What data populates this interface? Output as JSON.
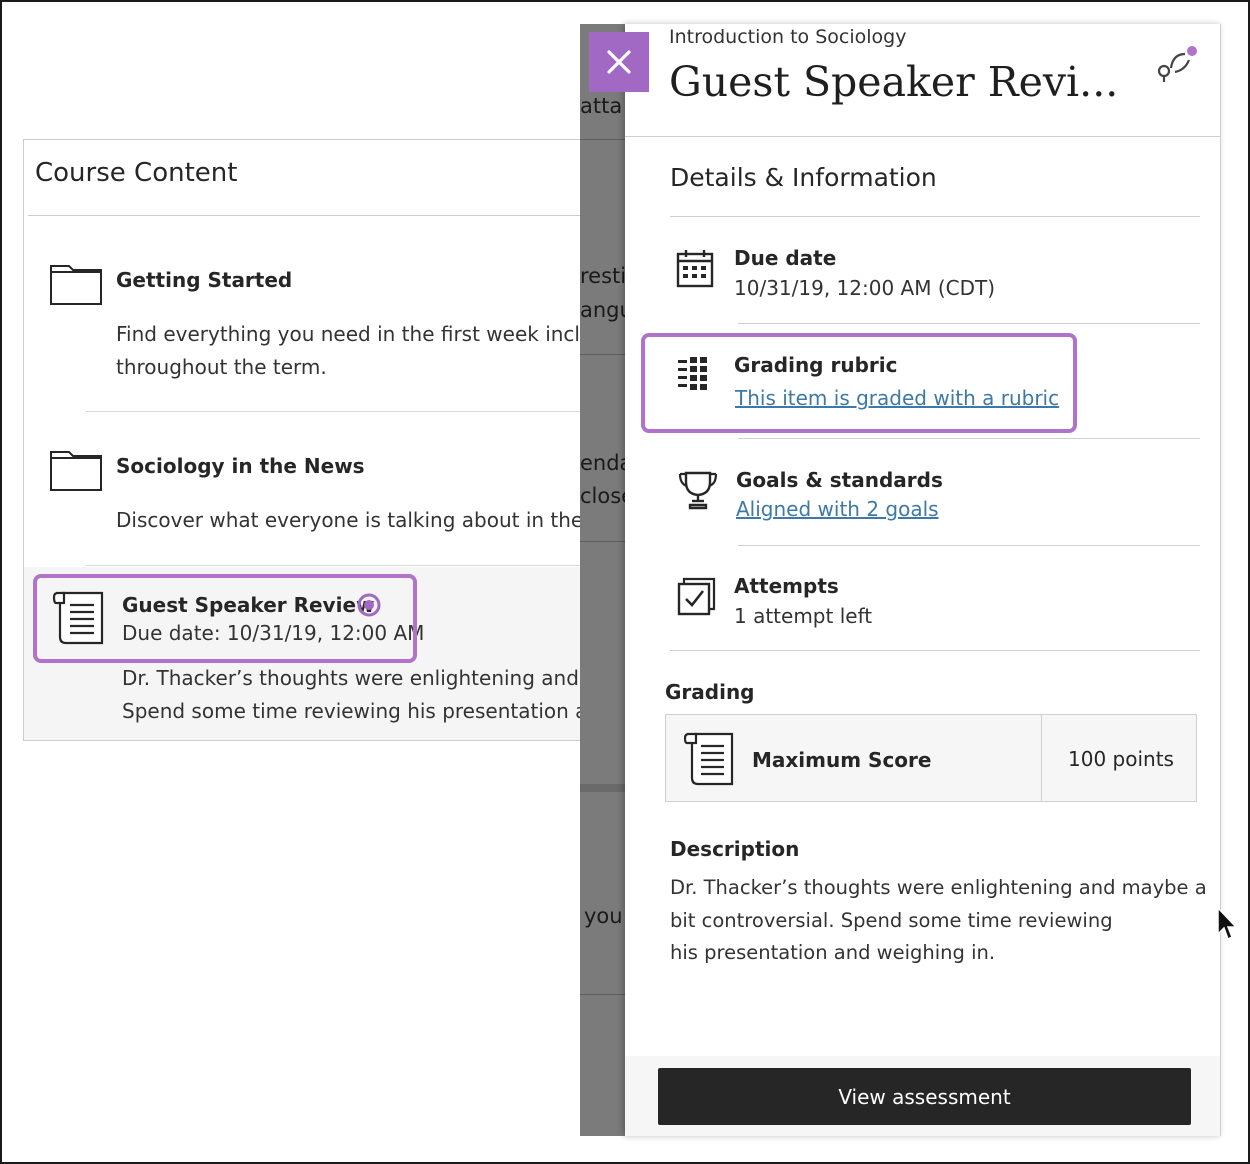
{
  "course": {
    "title": "Course Content",
    "items": [
      {
        "title": "Getting Started",
        "description_line1": "Find everything you need in the first week includ",
        "description_line2": "throughout the term.",
        "icon": "folder-icon"
      },
      {
        "title": "Sociology in the News",
        "description_line1": "Discover what everyone is talking about in the w",
        "icon": "folder-icon"
      },
      {
        "title": "Guest Speaker Review",
        "due": "Due date: 10/31/19, 12:00 AM",
        "description_line1": "Dr. Thacker’s thoughts were enlightening and m",
        "description_line2": "Spend some time reviewing his presentation an",
        "icon": "document-icon",
        "badge_icon": "new-activity-icon"
      }
    ]
  },
  "background_fragments": {
    "t1": "atta",
    "t2": "resti",
    "t3": "angu",
    "t4": "enda",
    "t5": "close",
    "t6": "you"
  },
  "panel": {
    "course_name": "Introduction to Sociology",
    "title": "Guest Speaker Revi...",
    "section_title": "Details & Information",
    "due": {
      "label": "Due date",
      "value": "10/31/19, 12:00 AM (CDT)"
    },
    "rubric": {
      "label": "Grading rubric",
      "link": "This item is graded with a rubric"
    },
    "goals": {
      "label": "Goals & standards",
      "link": "Aligned with 2 goals"
    },
    "attempts": {
      "label": "Attempts",
      "value": "1 attempt left"
    },
    "grading": {
      "label": "Grading",
      "score_label": "Maximum Score",
      "score_value": "100 points"
    },
    "description": {
      "label": "Description",
      "text": "Dr. Thacker’s thoughts were enlightening and maybe a\nbit controversial. Spend some  time reviewing\nhis presentation and weighing in."
    },
    "button": "View assessment"
  },
  "colors": {
    "accent": "#a168c4",
    "highlight": "#b073c9",
    "link": "#3d79a8",
    "button_bg": "#262626"
  }
}
